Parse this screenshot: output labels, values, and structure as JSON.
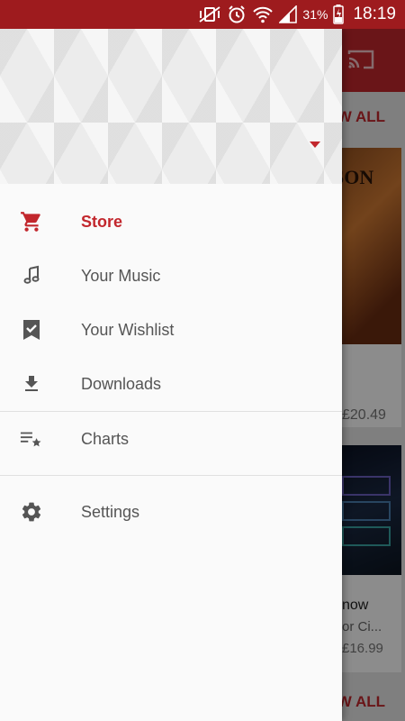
{
  "status_bar": {
    "battery": "31%",
    "time": "18:19"
  },
  "background": {
    "view_all_top": "VIEW ALL",
    "card1_art_text": "SON",
    "card1_price": "£20.49",
    "card2_title": "now",
    "card2_subtitle": "or Ci...",
    "card2_price": "£16.99",
    "view_all_bottom": "VIEW ALL"
  },
  "drawer": {
    "items": [
      {
        "label": "Store",
        "icon": "cart-icon",
        "active": true
      },
      {
        "label": "Your Music",
        "icon": "music-note-icon",
        "active": false
      },
      {
        "label": "Your Wishlist",
        "icon": "bookmark-check-icon",
        "active": false
      },
      {
        "label": "Downloads",
        "icon": "download-icon",
        "active": false
      },
      {
        "label": "Charts",
        "icon": "charts-list-star-icon",
        "active": false
      },
      {
        "label": "Settings",
        "icon": "gear-icon",
        "active": false
      }
    ]
  },
  "colors": {
    "brand_red": "#c2272d",
    "status_red": "#9e1b1e",
    "icon_gray": "#555555"
  }
}
